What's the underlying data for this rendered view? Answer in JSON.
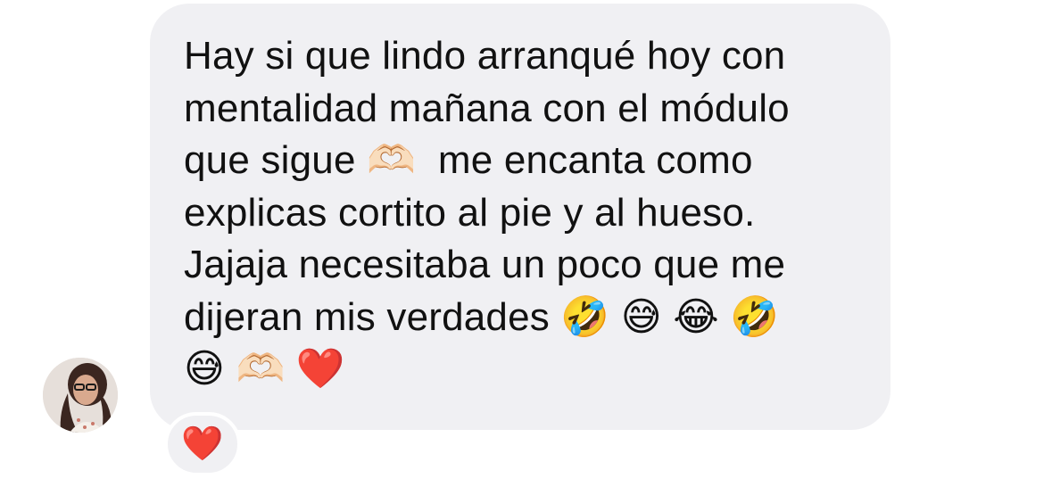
{
  "message": {
    "lines": [
      "Hay si que lindo arranqué hoy con",
      "mentalidad mañana con el módulo",
      "que sigue 🫶🏻  me encanta como",
      "explicas cortito al pie y al hueso.",
      "Jajaja necesitaba un poco que me",
      "dijeran mis verdades 🤣 😅 😂 🤣",
      "😅 🫶🏻 ❤️"
    ]
  },
  "reaction": {
    "emoji": "❤️"
  },
  "colors": {
    "bubble": "#f0f0f3",
    "text": "#111111",
    "background": "#ffffff"
  }
}
